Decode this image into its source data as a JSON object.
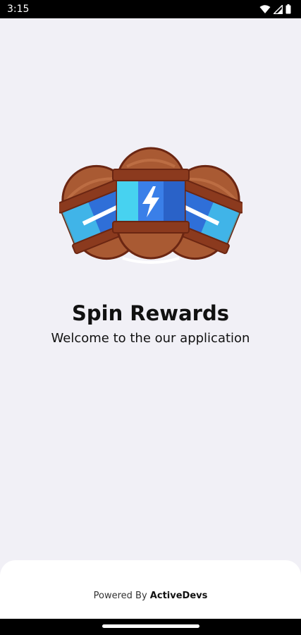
{
  "status_bar": {
    "time": "3:15",
    "icons": [
      "wifi-icon",
      "cellular-signal-icon",
      "battery-icon"
    ]
  },
  "splash": {
    "logo_icon": "spin-rewards-coin-bags-logo",
    "title": "Spin Rewards",
    "subtitle": "Welcome to the our application"
  },
  "footer": {
    "powered_prefix": "Powered By",
    "brand": "ActiveDevs"
  },
  "colors": {
    "background": "#f1f0f6",
    "text": "#111111",
    "bag_brown": "#a95a33",
    "bag_band_blue": "#2f8fe0",
    "bag_band_cyan": "#47d2f0",
    "outline": "#6b2612"
  }
}
